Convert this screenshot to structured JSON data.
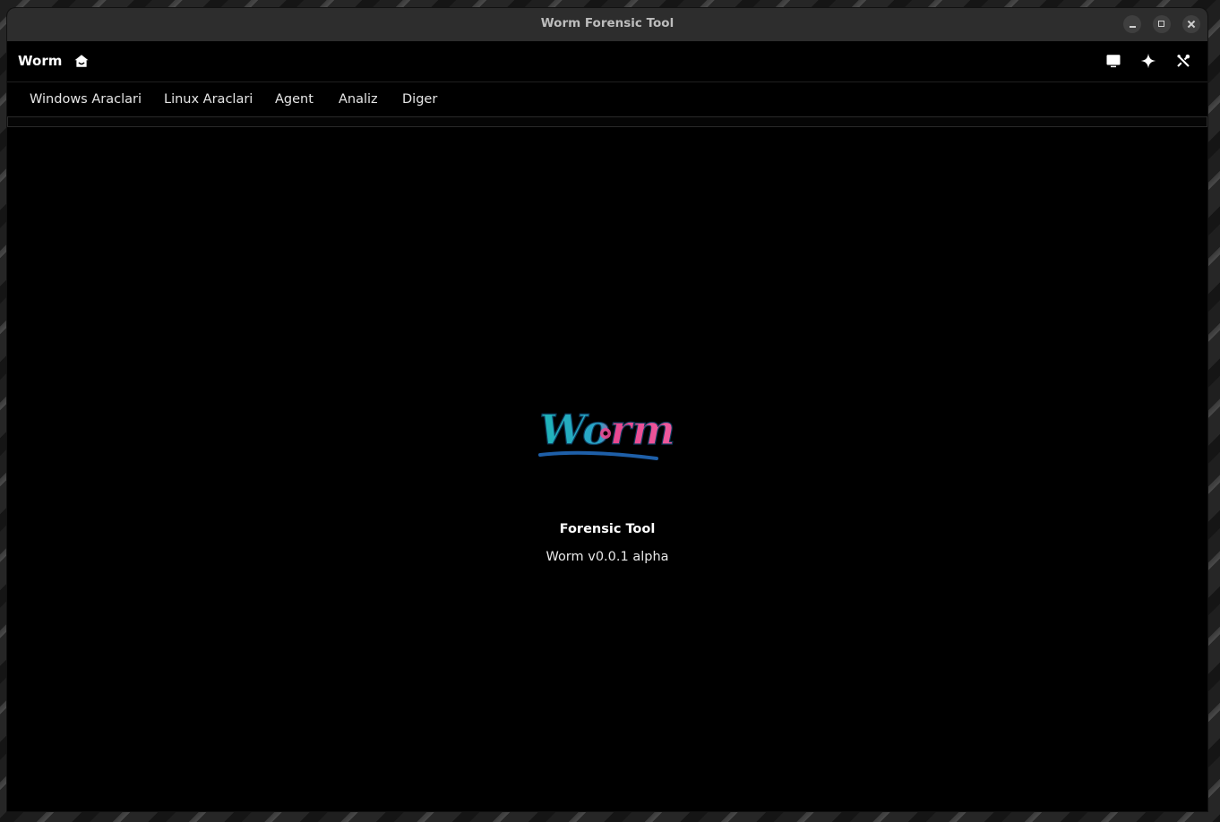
{
  "window": {
    "title": "Worm Forensic Tool"
  },
  "appbar": {
    "title": "Worm",
    "home_icon": "home-icon",
    "actions": [
      {
        "icon": "screen-icon"
      },
      {
        "icon": "sparkle-icon"
      },
      {
        "icon": "tools-icon"
      }
    ]
  },
  "menu": {
    "items": [
      {
        "label": "Windows Araclari"
      },
      {
        "label": "Linux Araclari"
      },
      {
        "label": "Agent"
      },
      {
        "label": "Analiz"
      },
      {
        "label": "Diger"
      }
    ]
  },
  "main": {
    "logo_text": "Worm",
    "subtitle": "Forensic Tool",
    "version": "Worm v0.0.1 alpha"
  },
  "colors": {
    "background": "#000000",
    "titlebar": "#2d2d2d",
    "logo_teal": "#1fb5b8",
    "logo_pink": "#e8478f",
    "logo_blue": "#1e5fa8"
  }
}
